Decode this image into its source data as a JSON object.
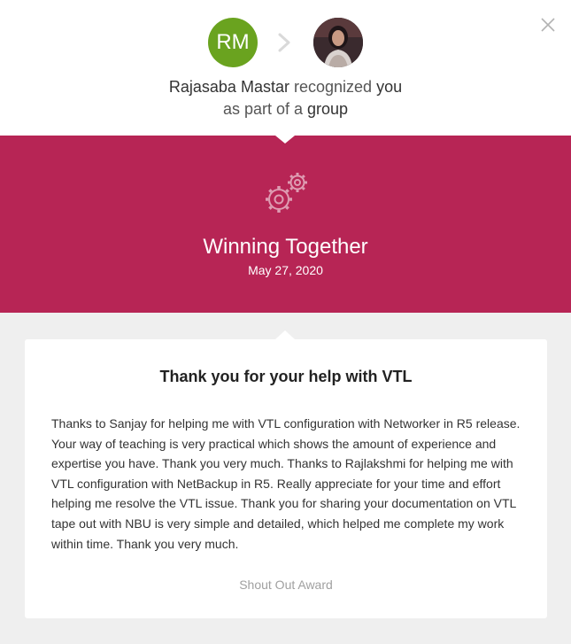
{
  "header": {
    "initials": "RM",
    "sender_name": "Rajasaba Mastar",
    "action_text": "recognized",
    "recipient_text": "you",
    "line2_prefix": "as part of a",
    "line2_group": "group"
  },
  "award": {
    "icon": "gears-icon",
    "title": "Winning Together",
    "date": "May 27, 2020"
  },
  "message": {
    "title": "Thank you for your help with VTL",
    "body": "Thanks to Sanjay for helping me with VTL configuration with Networker in R5 release. Your way of teaching is very practical which shows the amount of experience and expertise you have. Thank you very much. Thanks to Rajlakshmi for helping me with VTL configuration with NetBackup in R5. Really appreciate for your time and effort helping me resolve the VTL issue. Thank you for sharing your documentation on VTL tape out with NBU is very simple and detailed, which helped me complete my work within time. Thank you very much.",
    "award_type": "Shout Out Award"
  },
  "colors": {
    "banner": "#b72555",
    "avatar_bg": "#6aa31f",
    "background": "#efefef"
  }
}
